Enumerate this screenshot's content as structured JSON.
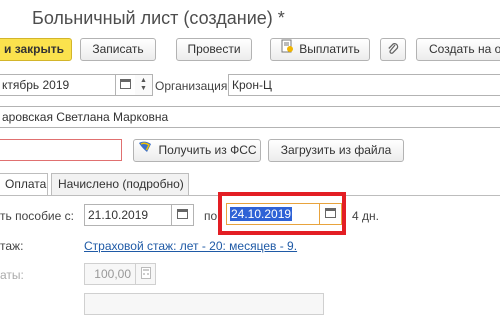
{
  "window": {
    "title": "Больничный лист (создание) *"
  },
  "toolbar": {
    "post_and_close": "и закрыть",
    "save": "Записать",
    "post": "Провести",
    "pay": "Выплатить",
    "create_based_on": "Создать на о"
  },
  "header": {
    "month_value": "ктябрь 2019",
    "org_label": "Организация:",
    "org_value": "Крон-Ц",
    "employee_value": "аровская Светлана Марковна"
  },
  "fss": {
    "get_from_fss": "Получить из ФСС",
    "load_from_file": "Загрузить из файла"
  },
  "tabs": [
    "Оплата",
    "Начислено (подробно)"
  ],
  "payment": {
    "benefit_from_label": "ть пособие с:",
    "date_from": "21.10.2019",
    "to_label": "по",
    "date_to": "24.10.2019",
    "days": "4 дн.",
    "insurance_label": "таж:",
    "insurance_link": "Страховой стаж: лет - 20: месяцев - 9.",
    "payment_label": "аты:",
    "payment_value": "100,00"
  },
  "colors": {
    "accent": "#fbe24d",
    "highlight_box": "#e31e24",
    "link": "#1f5aa6",
    "selection": "#2e62d6"
  },
  "icons": {
    "pay": "document-pay-icon",
    "attach": "paperclip-icon",
    "fss": "fss-logo-icon",
    "calendar": "calendar-icon",
    "calc": "calculator-icon"
  }
}
